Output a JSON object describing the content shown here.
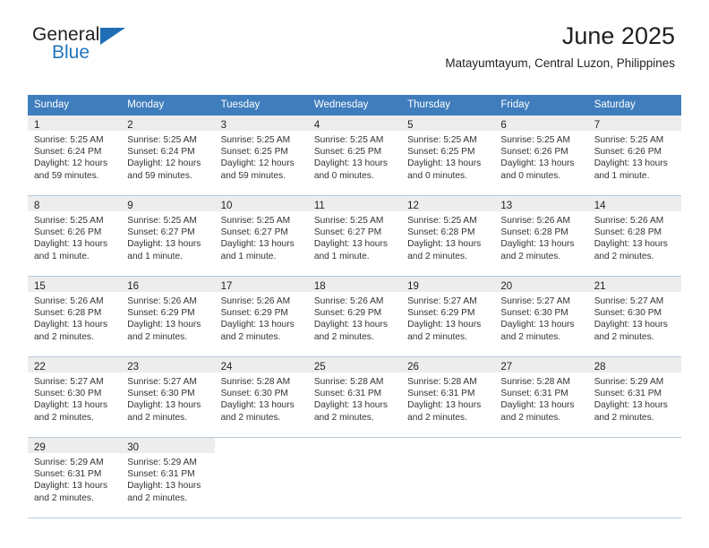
{
  "logo": {
    "text_top": "General",
    "text_bottom": "Blue",
    "triangle_icon": "triangle-icon",
    "color_dark": "#231f20",
    "color_blue": "#2275bb"
  },
  "header": {
    "title": "June 2025",
    "subtitle": "Matayumtayum, Central Luzon, Philippines"
  },
  "theme": {
    "header_bg": "#3f7dbd",
    "header_text": "#ffffff",
    "daynum_bg": "#ededed",
    "grid_line": "#b9c9da",
    "body_text": "#333333"
  },
  "weekdays": [
    "Sunday",
    "Monday",
    "Tuesday",
    "Wednesday",
    "Thursday",
    "Friday",
    "Saturday"
  ],
  "weeks": [
    [
      {
        "day": "1",
        "sunrise": "Sunrise: 5:25 AM",
        "sunset": "Sunset: 6:24 PM",
        "daylight1": "Daylight: 12 hours",
        "daylight2": "and 59 minutes."
      },
      {
        "day": "2",
        "sunrise": "Sunrise: 5:25 AM",
        "sunset": "Sunset: 6:24 PM",
        "daylight1": "Daylight: 12 hours",
        "daylight2": "and 59 minutes."
      },
      {
        "day": "3",
        "sunrise": "Sunrise: 5:25 AM",
        "sunset": "Sunset: 6:25 PM",
        "daylight1": "Daylight: 12 hours",
        "daylight2": "and 59 minutes."
      },
      {
        "day": "4",
        "sunrise": "Sunrise: 5:25 AM",
        "sunset": "Sunset: 6:25 PM",
        "daylight1": "Daylight: 13 hours",
        "daylight2": "and 0 minutes."
      },
      {
        "day": "5",
        "sunrise": "Sunrise: 5:25 AM",
        "sunset": "Sunset: 6:25 PM",
        "daylight1": "Daylight: 13 hours",
        "daylight2": "and 0 minutes."
      },
      {
        "day": "6",
        "sunrise": "Sunrise: 5:25 AM",
        "sunset": "Sunset: 6:26 PM",
        "daylight1": "Daylight: 13 hours",
        "daylight2": "and 0 minutes."
      },
      {
        "day": "7",
        "sunrise": "Sunrise: 5:25 AM",
        "sunset": "Sunset: 6:26 PM",
        "daylight1": "Daylight: 13 hours",
        "daylight2": "and 1 minute."
      }
    ],
    [
      {
        "day": "8",
        "sunrise": "Sunrise: 5:25 AM",
        "sunset": "Sunset: 6:26 PM",
        "daylight1": "Daylight: 13 hours",
        "daylight2": "and 1 minute."
      },
      {
        "day": "9",
        "sunrise": "Sunrise: 5:25 AM",
        "sunset": "Sunset: 6:27 PM",
        "daylight1": "Daylight: 13 hours",
        "daylight2": "and 1 minute."
      },
      {
        "day": "10",
        "sunrise": "Sunrise: 5:25 AM",
        "sunset": "Sunset: 6:27 PM",
        "daylight1": "Daylight: 13 hours",
        "daylight2": "and 1 minute."
      },
      {
        "day": "11",
        "sunrise": "Sunrise: 5:25 AM",
        "sunset": "Sunset: 6:27 PM",
        "daylight1": "Daylight: 13 hours",
        "daylight2": "and 1 minute."
      },
      {
        "day": "12",
        "sunrise": "Sunrise: 5:25 AM",
        "sunset": "Sunset: 6:28 PM",
        "daylight1": "Daylight: 13 hours",
        "daylight2": "and 2 minutes."
      },
      {
        "day": "13",
        "sunrise": "Sunrise: 5:26 AM",
        "sunset": "Sunset: 6:28 PM",
        "daylight1": "Daylight: 13 hours",
        "daylight2": "and 2 minutes."
      },
      {
        "day": "14",
        "sunrise": "Sunrise: 5:26 AM",
        "sunset": "Sunset: 6:28 PM",
        "daylight1": "Daylight: 13 hours",
        "daylight2": "and 2 minutes."
      }
    ],
    [
      {
        "day": "15",
        "sunrise": "Sunrise: 5:26 AM",
        "sunset": "Sunset: 6:28 PM",
        "daylight1": "Daylight: 13 hours",
        "daylight2": "and 2 minutes."
      },
      {
        "day": "16",
        "sunrise": "Sunrise: 5:26 AM",
        "sunset": "Sunset: 6:29 PM",
        "daylight1": "Daylight: 13 hours",
        "daylight2": "and 2 minutes."
      },
      {
        "day": "17",
        "sunrise": "Sunrise: 5:26 AM",
        "sunset": "Sunset: 6:29 PM",
        "daylight1": "Daylight: 13 hours",
        "daylight2": "and 2 minutes."
      },
      {
        "day": "18",
        "sunrise": "Sunrise: 5:26 AM",
        "sunset": "Sunset: 6:29 PM",
        "daylight1": "Daylight: 13 hours",
        "daylight2": "and 2 minutes."
      },
      {
        "day": "19",
        "sunrise": "Sunrise: 5:27 AM",
        "sunset": "Sunset: 6:29 PM",
        "daylight1": "Daylight: 13 hours",
        "daylight2": "and 2 minutes."
      },
      {
        "day": "20",
        "sunrise": "Sunrise: 5:27 AM",
        "sunset": "Sunset: 6:30 PM",
        "daylight1": "Daylight: 13 hours",
        "daylight2": "and 2 minutes."
      },
      {
        "day": "21",
        "sunrise": "Sunrise: 5:27 AM",
        "sunset": "Sunset: 6:30 PM",
        "daylight1": "Daylight: 13 hours",
        "daylight2": "and 2 minutes."
      }
    ],
    [
      {
        "day": "22",
        "sunrise": "Sunrise: 5:27 AM",
        "sunset": "Sunset: 6:30 PM",
        "daylight1": "Daylight: 13 hours",
        "daylight2": "and 2 minutes."
      },
      {
        "day": "23",
        "sunrise": "Sunrise: 5:27 AM",
        "sunset": "Sunset: 6:30 PM",
        "daylight1": "Daylight: 13 hours",
        "daylight2": "and 2 minutes."
      },
      {
        "day": "24",
        "sunrise": "Sunrise: 5:28 AM",
        "sunset": "Sunset: 6:30 PM",
        "daylight1": "Daylight: 13 hours",
        "daylight2": "and 2 minutes."
      },
      {
        "day": "25",
        "sunrise": "Sunrise: 5:28 AM",
        "sunset": "Sunset: 6:31 PM",
        "daylight1": "Daylight: 13 hours",
        "daylight2": "and 2 minutes."
      },
      {
        "day": "26",
        "sunrise": "Sunrise: 5:28 AM",
        "sunset": "Sunset: 6:31 PM",
        "daylight1": "Daylight: 13 hours",
        "daylight2": "and 2 minutes."
      },
      {
        "day": "27",
        "sunrise": "Sunrise: 5:28 AM",
        "sunset": "Sunset: 6:31 PM",
        "daylight1": "Daylight: 13 hours",
        "daylight2": "and 2 minutes."
      },
      {
        "day": "28",
        "sunrise": "Sunrise: 5:29 AM",
        "sunset": "Sunset: 6:31 PM",
        "daylight1": "Daylight: 13 hours",
        "daylight2": "and 2 minutes."
      }
    ],
    [
      {
        "day": "29",
        "sunrise": "Sunrise: 5:29 AM",
        "sunset": "Sunset: 6:31 PM",
        "daylight1": "Daylight: 13 hours",
        "daylight2": "and 2 minutes."
      },
      {
        "day": "30",
        "sunrise": "Sunrise: 5:29 AM",
        "sunset": "Sunset: 6:31 PM",
        "daylight1": "Daylight: 13 hours",
        "daylight2": "and 2 minutes."
      },
      {
        "day": "",
        "sunrise": "",
        "sunset": "",
        "daylight1": "",
        "daylight2": ""
      },
      {
        "day": "",
        "sunrise": "",
        "sunset": "",
        "daylight1": "",
        "daylight2": ""
      },
      {
        "day": "",
        "sunrise": "",
        "sunset": "",
        "daylight1": "",
        "daylight2": ""
      },
      {
        "day": "",
        "sunrise": "",
        "sunset": "",
        "daylight1": "",
        "daylight2": ""
      },
      {
        "day": "",
        "sunrise": "",
        "sunset": "",
        "daylight1": "",
        "daylight2": ""
      }
    ]
  ]
}
